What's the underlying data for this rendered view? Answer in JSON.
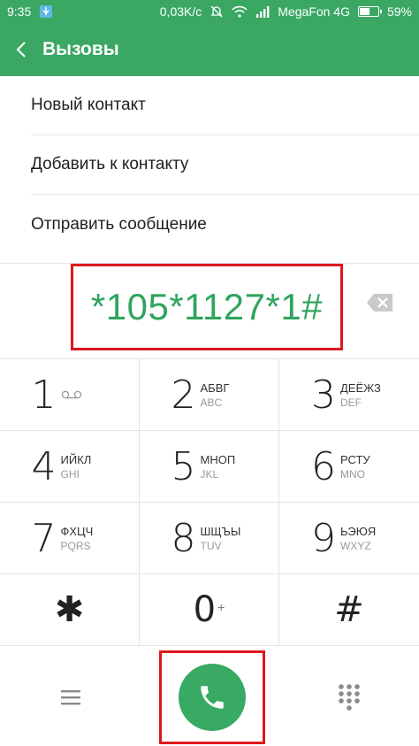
{
  "status": {
    "time": "9:35",
    "speed": "0,03K/c",
    "carrier": "MegaFon 4G",
    "battery": "59%",
    "battery_level": 0.59
  },
  "header": {
    "title": "Вызовы"
  },
  "menu": {
    "items": [
      {
        "label": "Новый контакт"
      },
      {
        "label": "Добавить к контакту"
      },
      {
        "label": "Отправить сообщение"
      }
    ]
  },
  "dial": {
    "number": "*105*1127*1#"
  },
  "keypad": {
    "keys": [
      {
        "digit": "1",
        "cyr": "",
        "lat": ""
      },
      {
        "digit": "2",
        "cyr": "АБВГ",
        "lat": "ABC"
      },
      {
        "digit": "3",
        "cyr": "ДЕЁЖЗ",
        "lat": "DEF"
      },
      {
        "digit": "4",
        "cyr": "ИЙКЛ",
        "lat": "GHI"
      },
      {
        "digit": "5",
        "cyr": "МНОП",
        "lat": "JKL"
      },
      {
        "digit": "6",
        "cyr": "РСТУ",
        "lat": "MNO"
      },
      {
        "digit": "7",
        "cyr": "ФХЦЧ",
        "lat": "PQRS"
      },
      {
        "digit": "8",
        "cyr": "ШЩЪЫ",
        "lat": "TUV"
      },
      {
        "digit": "9",
        "cyr": "ЬЭЮЯ",
        "lat": "WXYZ"
      },
      {
        "digit": "✱"
      },
      {
        "digit": "0",
        "sub": "+"
      },
      {
        "digit": "#"
      }
    ]
  },
  "icons": {
    "usb": "usb-icon",
    "mute": "bell-off-icon",
    "wifi": "wifi-icon",
    "signal": "signal-icon",
    "battery": "battery-icon",
    "back": "chevron-left-icon",
    "backspace": "backspace-icon",
    "voicemail": "voicemail-icon",
    "menu": "hamburger-icon",
    "call": "phone-icon",
    "dialpad": "dialpad-icon"
  },
  "colors": {
    "accent": "#3aa863",
    "number_text": "#2fa55d",
    "highlight_border": "#e0161e"
  }
}
